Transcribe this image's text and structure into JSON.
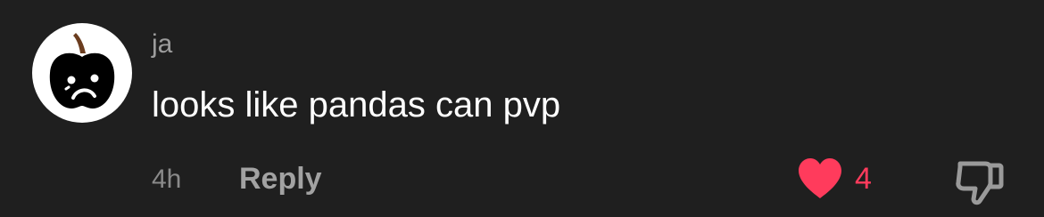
{
  "comment": {
    "username": "ja",
    "text": "looks like pandas can pvp",
    "timestamp": "4h",
    "reply_label": "Reply",
    "like_count": "4",
    "liked": true
  },
  "colors": {
    "background": "#1f1f1f",
    "username": "#9c9c9c",
    "text": "#ffffff",
    "meta": "#8a8a8a",
    "reply": "#a2a2a2",
    "like": "#ff3b5c"
  },
  "icons": {
    "avatar": "black-apple-sad-face-avatar",
    "like": "heart-icon",
    "dislike": "thumbs-down-icon"
  }
}
